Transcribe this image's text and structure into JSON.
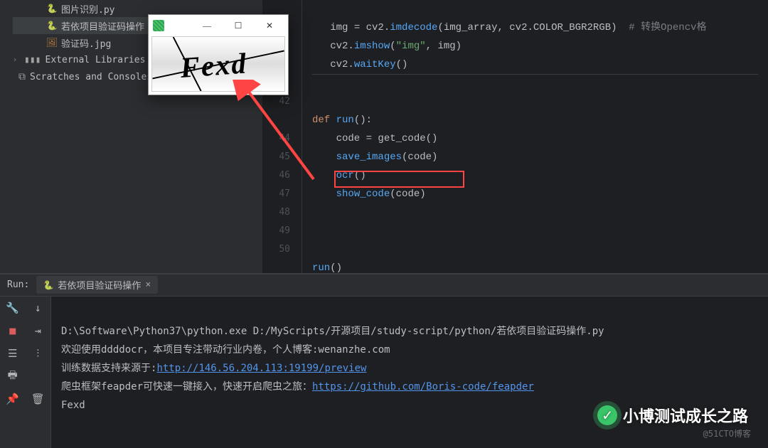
{
  "sidebar": {
    "items": [
      {
        "label": "图片识别.py",
        "icon": "python",
        "indent": "indent1"
      },
      {
        "label": "若依项目验证码操作",
        "icon": "python",
        "indent": "indent1",
        "selected": true
      },
      {
        "label": "验证码.jpg",
        "icon": "image",
        "indent": "indent1"
      }
    ],
    "external_libs": "External Libraries",
    "scratches": "Scratches and Consoles"
  },
  "gutter": {
    "visible_lines": [
      "",
      "",
      "",
      "",
      "",
      "42",
      "",
      "44",
      "45",
      "46",
      "47",
      "48",
      "49",
      "50"
    ]
  },
  "code": {
    "l1a": "img = cv2.",
    "l1b": "imdecode",
    "l1c": "(img_array, cv2.COLOR_BGR2RGB)  ",
    "l1d": "# 转换Opencv格",
    "l2a": "cv2.",
    "l2b": "imshow",
    "l2c": "(",
    "l2d": "\"img\"",
    "l2e": ", img)",
    "l3a": "cv2.",
    "l3b": "waitKey",
    "l3c": "()",
    "l5a": "def",
    "l5b": " ",
    "l5c": "run",
    "l5d": "():",
    "l6": "    code = get_code()",
    "l7a": "    ",
    "l7b": "save_images",
    "l7c": "(code)",
    "l8a": "    ",
    "l8b": "ocr",
    "l8c": "()",
    "l9a": "    ",
    "l9b": "show_code",
    "l9c": "(code)",
    "l10a": "run",
    "l10b": "()"
  },
  "run_panel": {
    "label": "Run:",
    "tab": "若依项目验证码操作",
    "close": "×"
  },
  "console": {
    "l1": "D:\\Software\\Python37\\python.exe D:/MyScripts/开源项目/study-script/python/若依项目验证码操作.py",
    "l2": "欢迎使用ddddocr，本项目专注带动行业内卷，个人博客:wenanzhe.com",
    "l3a": "训练数据支持来源于:",
    "l3link": "http://146.56.204.113:19199/preview",
    "l4a": "爬虫框架feapder可快速一键接入，快速开启爬虫之旅：",
    "l4link": "https://github.com/Boris-code/feapder",
    "l5": "Fexd"
  },
  "popup": {
    "min": "—",
    "max": "☐",
    "close": "✕",
    "captcha_text": "Fexd"
  },
  "watermark": {
    "brand": "小博测试成长之路",
    "small": "@51CTO博客"
  },
  "icons": {
    "rerun": "↻",
    "up": "↑",
    "wrench": "🔧",
    "down": "↓",
    "stop": "■",
    "jump": "⇥",
    "stack": "☰",
    "sep": "⫶",
    "print": "🖶",
    "trash": "🗑",
    "pin": "📌"
  }
}
